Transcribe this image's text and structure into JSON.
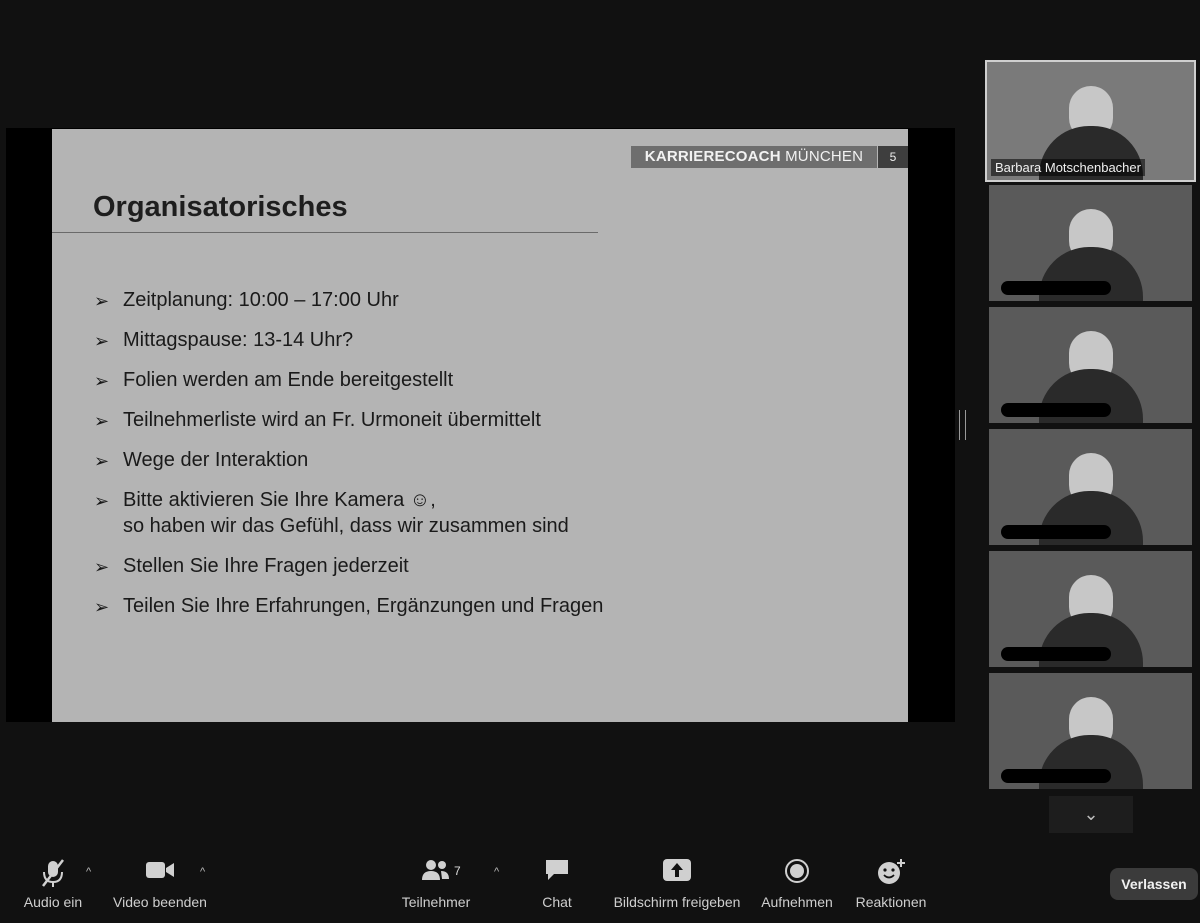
{
  "slide": {
    "brand_bold": "KARRIERECOACH",
    "brand_light": "MÜNCHEN",
    "page_number": "5",
    "title": "Organisatorisches",
    "bullets": [
      {
        "line1": "Zeitplanung: 10:00 – 17:00 Uhr"
      },
      {
        "line1": "Mittagspause: 13-14 Uhr?"
      },
      {
        "line1": "Folien werden am Ende bereitgestellt"
      },
      {
        "line1": "Teilnehmerliste wird an Fr. Urmoneit übermittelt"
      },
      {
        "line1": "Wege der Interaktion"
      },
      {
        "line1": "Bitte aktivieren Sie Ihre Kamera ☺,",
        "line2": "so haben wir das Gefühl, dass wir zusammen sind"
      },
      {
        "line1": "Stellen Sie Ihre Fragen jederzeit"
      },
      {
        "line1": "Teilen Sie Ihre Erfahrungen, Ergänzungen und Fragen"
      }
    ]
  },
  "participants": {
    "active_speaker": "Barbara Motschenbacher"
  },
  "toolbar": {
    "audio_label": "Audio ein",
    "video_label": "Video beenden",
    "participants_label": "Teilnehmer",
    "participants_count": "7",
    "chat_label": "Chat",
    "share_label": "Bildschirm freigeben",
    "record_label": "Aufnehmen",
    "reactions_label": "Reaktionen",
    "leave_label": "Verlassen"
  }
}
